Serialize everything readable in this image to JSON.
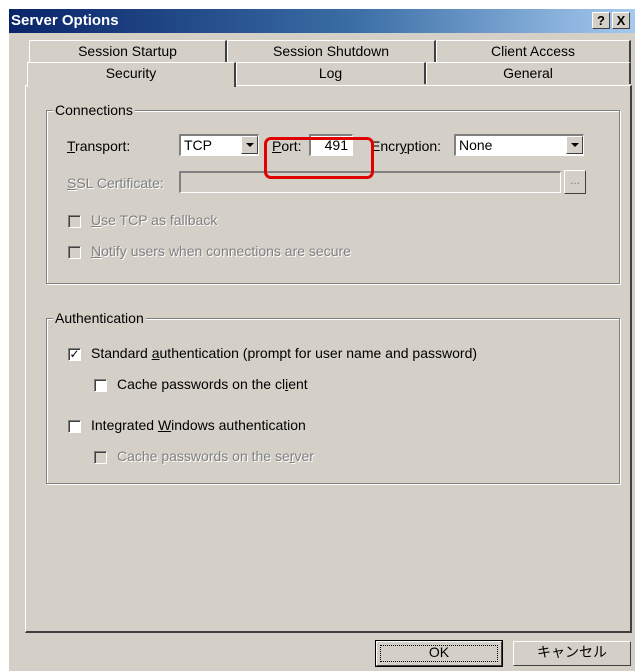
{
  "window": {
    "title": "Server Options",
    "help_label": "?",
    "close_label": "X"
  },
  "tabs": {
    "row1": [
      "Session Startup",
      "Session Shutdown",
      "Client Access"
    ],
    "row2": [
      "Security",
      "Log",
      "General"
    ],
    "active": "Security"
  },
  "connections": {
    "legend": "Connections",
    "transport_label": "Transport:",
    "transport_value": "TCP",
    "port_label": "Port:",
    "port_value": "491",
    "encryption_label": "Encryption:",
    "encryption_value": "None",
    "ssl_label": "SSL Certificate:",
    "ssl_value": "",
    "browse_label": "...",
    "use_tcp_fallback": {
      "label": "Use TCP as fallback",
      "checked": false,
      "enabled": false
    },
    "notify_secure": {
      "label": "Notify users when connections are secure",
      "checked": false,
      "enabled": false
    }
  },
  "authentication": {
    "legend": "Authentication",
    "standard_auth": {
      "label": "Standard authentication (prompt for user name and password)",
      "checked": true
    },
    "cache_client": {
      "label": "Cache passwords on the client",
      "checked": false
    },
    "integrated_auth": {
      "label": "Integrated Windows authentication",
      "checked": false
    },
    "cache_server": {
      "label": "Cache passwords on the server",
      "checked": false,
      "enabled": false
    }
  },
  "buttons": {
    "ok": "OK",
    "cancel": "キャンセル"
  },
  "colors": {
    "title_start": "#0a246a",
    "title_end": "#a6caf0",
    "highlight": "#e00000",
    "face": "#d4d0c8"
  }
}
